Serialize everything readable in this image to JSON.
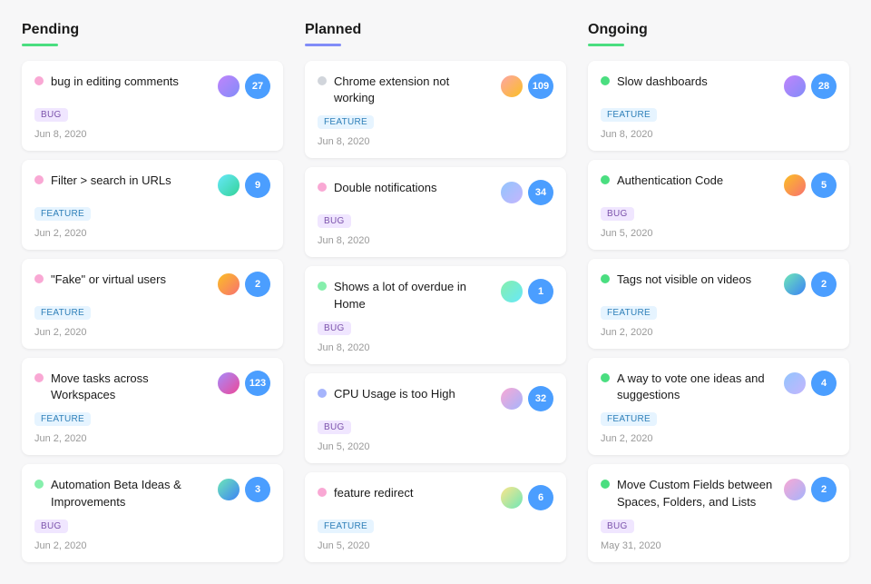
{
  "columns": [
    {
      "id": "pending",
      "title": "Pending",
      "underlineColor": "#4ade80",
      "cards": [
        {
          "id": "c1",
          "title": "bug in editing comments",
          "tag": "BUG",
          "tagType": "bug",
          "date": "Jun 8, 2020",
          "dotColor": "#f9a8d4",
          "count": "27",
          "avatarClass": "av1"
        },
        {
          "id": "c2",
          "title": "Filter > search in URLs",
          "tag": "FEATURE",
          "tagType": "feature",
          "date": "Jun 2, 2020",
          "dotColor": "#f9a8d4",
          "count": "9",
          "avatarClass": "av2"
        },
        {
          "id": "c3",
          "title": "\"Fake\" or virtual users",
          "tag": "FEATURE",
          "tagType": "feature",
          "date": "Jun 2, 2020",
          "dotColor": "#f9a8d4",
          "count": "2",
          "avatarClass": "av3"
        },
        {
          "id": "c4",
          "title": "Move tasks across Workspaces",
          "tag": "FEATURE",
          "tagType": "feature",
          "date": "Jun 2, 2020",
          "dotColor": "#f9a8d4",
          "count": "123",
          "avatarClass": "av4"
        },
        {
          "id": "c5",
          "title": "Automation Beta Ideas & Improvements",
          "tag": "BUG",
          "tagType": "bug",
          "date": "Jun 2, 2020",
          "dotColor": "#86efac",
          "count": "3",
          "avatarClass": "av5"
        }
      ]
    },
    {
      "id": "planned",
      "title": "Planned",
      "underlineColor": "#818cf8",
      "cards": [
        {
          "id": "p1",
          "title": "Chrome extension not working",
          "tag": "FEATURE",
          "tagType": "feature",
          "date": "Jun 8, 2020",
          "dotColor": "#d1d5db",
          "count": "109",
          "avatarClass": "av6"
        },
        {
          "id": "p2",
          "title": "Double notifications",
          "tag": "BUG",
          "tagType": "bug",
          "date": "Jun 8, 2020",
          "dotColor": "#f9a8d4",
          "count": "34",
          "avatarClass": "av7"
        },
        {
          "id": "p3",
          "title": "Shows a lot of overdue in Home",
          "tag": "BUG",
          "tagType": "bug",
          "date": "Jun 8, 2020",
          "dotColor": "#86efac",
          "count": "1",
          "avatarClass": "av8"
        },
        {
          "id": "p4",
          "title": "CPU Usage is too High",
          "tag": "BUG",
          "tagType": "bug",
          "date": "Jun 5, 2020",
          "dotColor": "#a5b4fc",
          "count": "32",
          "avatarClass": "av9"
        },
        {
          "id": "p5",
          "title": "feature redirect",
          "tag": "FEATURE",
          "tagType": "feature",
          "date": "Jun 5, 2020",
          "dotColor": "#f9a8d4",
          "count": "6",
          "avatarClass": "av10"
        }
      ]
    },
    {
      "id": "ongoing",
      "title": "Ongoing",
      "underlineColor": "#4ade80",
      "cards": [
        {
          "id": "o1",
          "title": "Slow dashboards",
          "tag": "FEATURE",
          "tagType": "feature",
          "date": "Jun 8, 2020",
          "dotColor": "#4ade80",
          "count": "28",
          "avatarClass": "av1"
        },
        {
          "id": "o2",
          "title": "Authentication Code",
          "tag": "BUG",
          "tagType": "bug",
          "date": "Jun 5, 2020",
          "dotColor": "#4ade80",
          "count": "5",
          "avatarClass": "av3"
        },
        {
          "id": "o3",
          "title": "Tags not visible on videos",
          "tag": "FEATURE",
          "tagType": "feature",
          "date": "Jun 2, 2020",
          "dotColor": "#4ade80",
          "count": "2",
          "avatarClass": "av5"
        },
        {
          "id": "o4",
          "title": "A way to vote one ideas and suggestions",
          "tag": "FEATURE",
          "tagType": "feature",
          "date": "Jun 2, 2020",
          "dotColor": "#4ade80",
          "count": "4",
          "avatarClass": "av7"
        },
        {
          "id": "o5",
          "title": "Move Custom Fields between Spaces, Folders, and Lists",
          "tag": "BUG",
          "tagType": "bug",
          "date": "May 31, 2020",
          "dotColor": "#4ade80",
          "count": "2",
          "avatarClass": "av9"
        }
      ]
    }
  ]
}
